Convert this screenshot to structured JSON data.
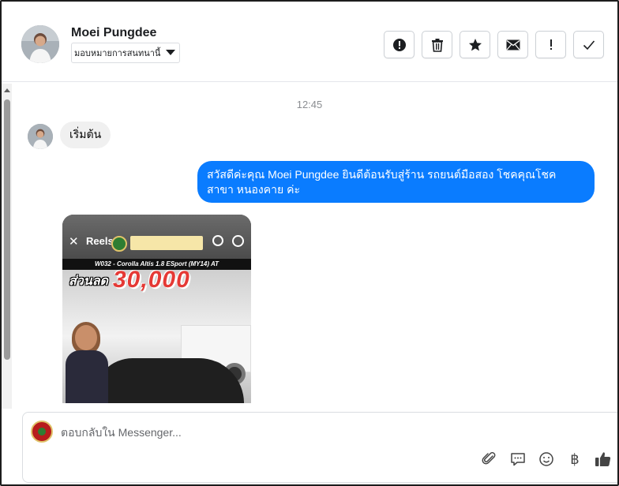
{
  "header": {
    "contact_name": "Moei Pungdee",
    "assign_label": "มอบหมายการสนทนานี้",
    "actions": [
      {
        "name": "mark-spam-button",
        "icon": "alert-circle-icon"
      },
      {
        "name": "delete-button",
        "icon": "trash-icon"
      },
      {
        "name": "star-button",
        "icon": "star-icon"
      },
      {
        "name": "mark-unread-button",
        "icon": "envelope-icon"
      },
      {
        "name": "follow-up-button",
        "icon": "exclamation-icon"
      },
      {
        "name": "mark-done-button",
        "icon": "checkmark-icon"
      }
    ]
  },
  "conversation": {
    "timestamp": "12:45",
    "messages": [
      {
        "direction": "incoming",
        "text": "เริ่มต้น"
      },
      {
        "direction": "outgoing",
        "text": "สวัสดีค่ะคุณ Moei Pungdee ยินดีต้อนรับสู่ร้าน รถยนต์มือสอง โชคคุณโชค สาขา หนองคาย ค่ะ"
      }
    ],
    "media": {
      "reels_label": "Reels",
      "model_text": "W032 - Corolla Altis 1.8 ESport (MY14) AT",
      "discount_label": "ส่วนลด",
      "discount_value": "30,000"
    }
  },
  "composer": {
    "placeholder": "ตอบกลับใน Messenger...",
    "tools": [
      "paperclip-icon",
      "chat-bubble-icon",
      "smiley-icon",
      "baht-icon",
      "thumbs-up-icon"
    ],
    "baht_symbol": "฿"
  },
  "colors": {
    "outgoing_bubble": "#0a7cff",
    "incoming_bubble": "#f0f0f0",
    "border": "#ccd0d5"
  }
}
